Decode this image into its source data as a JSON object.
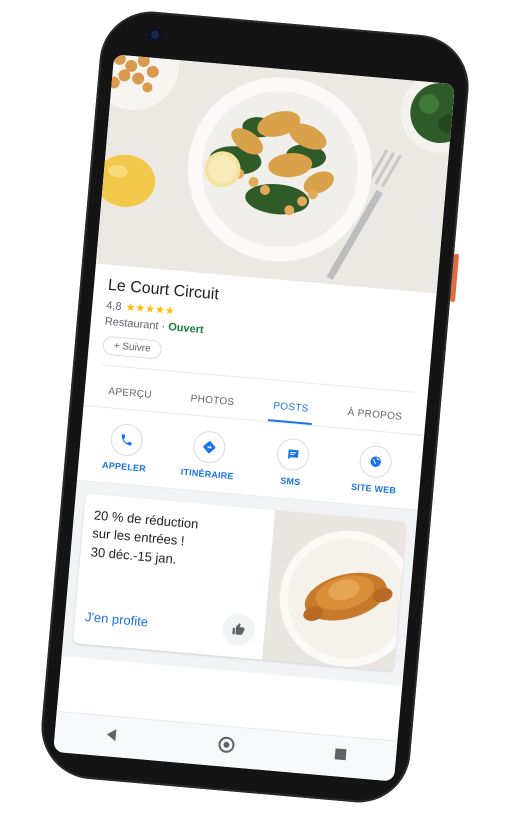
{
  "place": {
    "name": "Le Court Circuit",
    "rating": "4,8",
    "stars": "★★★★★",
    "category": "Restaurant",
    "separator": " · ",
    "status": "Ouvert",
    "follow_label": "+ Suivre"
  },
  "tabs": [
    {
      "label": "APERÇU",
      "active": false
    },
    {
      "label": "PHOTOS",
      "active": false
    },
    {
      "label": "POSTS",
      "active": true
    },
    {
      "label": "À PROPOS",
      "active": false
    }
  ],
  "actions": [
    {
      "label": "APPELER",
      "icon": "phone-icon"
    },
    {
      "label": "ITINÉRAIRE",
      "icon": "directions-icon"
    },
    {
      "label": "SMS",
      "icon": "sms-icon"
    },
    {
      "label": "SITE WEB",
      "icon": "globe-icon"
    }
  ],
  "post": {
    "offer_line1": "20 % de réduction",
    "offer_line2": "sur les entrées !",
    "dates": "30 déc.-15 jan.",
    "cta_label": "J'en profite",
    "like_icon": "thumbs-up-icon"
  },
  "colors": {
    "accent": "#1a73e8",
    "open": "#188038",
    "star": "#fbbc04",
    "side_button": "#e26a3c"
  }
}
